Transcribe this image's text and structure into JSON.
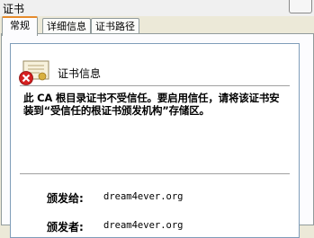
{
  "window": {
    "title": "证书"
  },
  "tabs": [
    {
      "label": "常规",
      "active": true
    },
    {
      "label": "详细信息",
      "active": false
    },
    {
      "label": "证书路径",
      "active": false
    }
  ],
  "cert": {
    "title": "证书信息",
    "warning": "此 CA 根目录证书不受信任。要启用信任，请将该证书安装到“受信任的根证书颁发机构”存储区。",
    "issued_to_label": "颁发给:",
    "issued_to_value": "dream4ever.org",
    "issued_by_label": "颁发者:",
    "issued_by_value": "dream4ever.org"
  }
}
